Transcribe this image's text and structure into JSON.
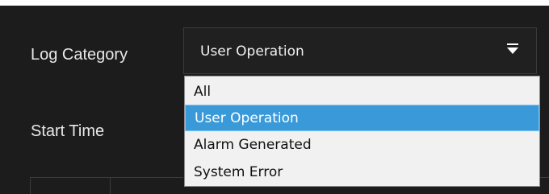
{
  "form": {
    "log_category_label": "Log Category",
    "start_time_label": "Start Time"
  },
  "log_category_select": {
    "value": "User Operation",
    "options": [
      {
        "label": "All",
        "selected": false
      },
      {
        "label": "User Operation",
        "selected": true
      },
      {
        "label": "Alarm Generated",
        "selected": false
      },
      {
        "label": "System Error",
        "selected": false
      }
    ]
  },
  "colors": {
    "panel_background": "#1c1c1c",
    "select_background": "#202020",
    "dropdown_background": "#f1f1f1",
    "selected_option": "#3a9ad9"
  },
  "icons": {
    "select_arrow": "chevron-down-icon"
  }
}
